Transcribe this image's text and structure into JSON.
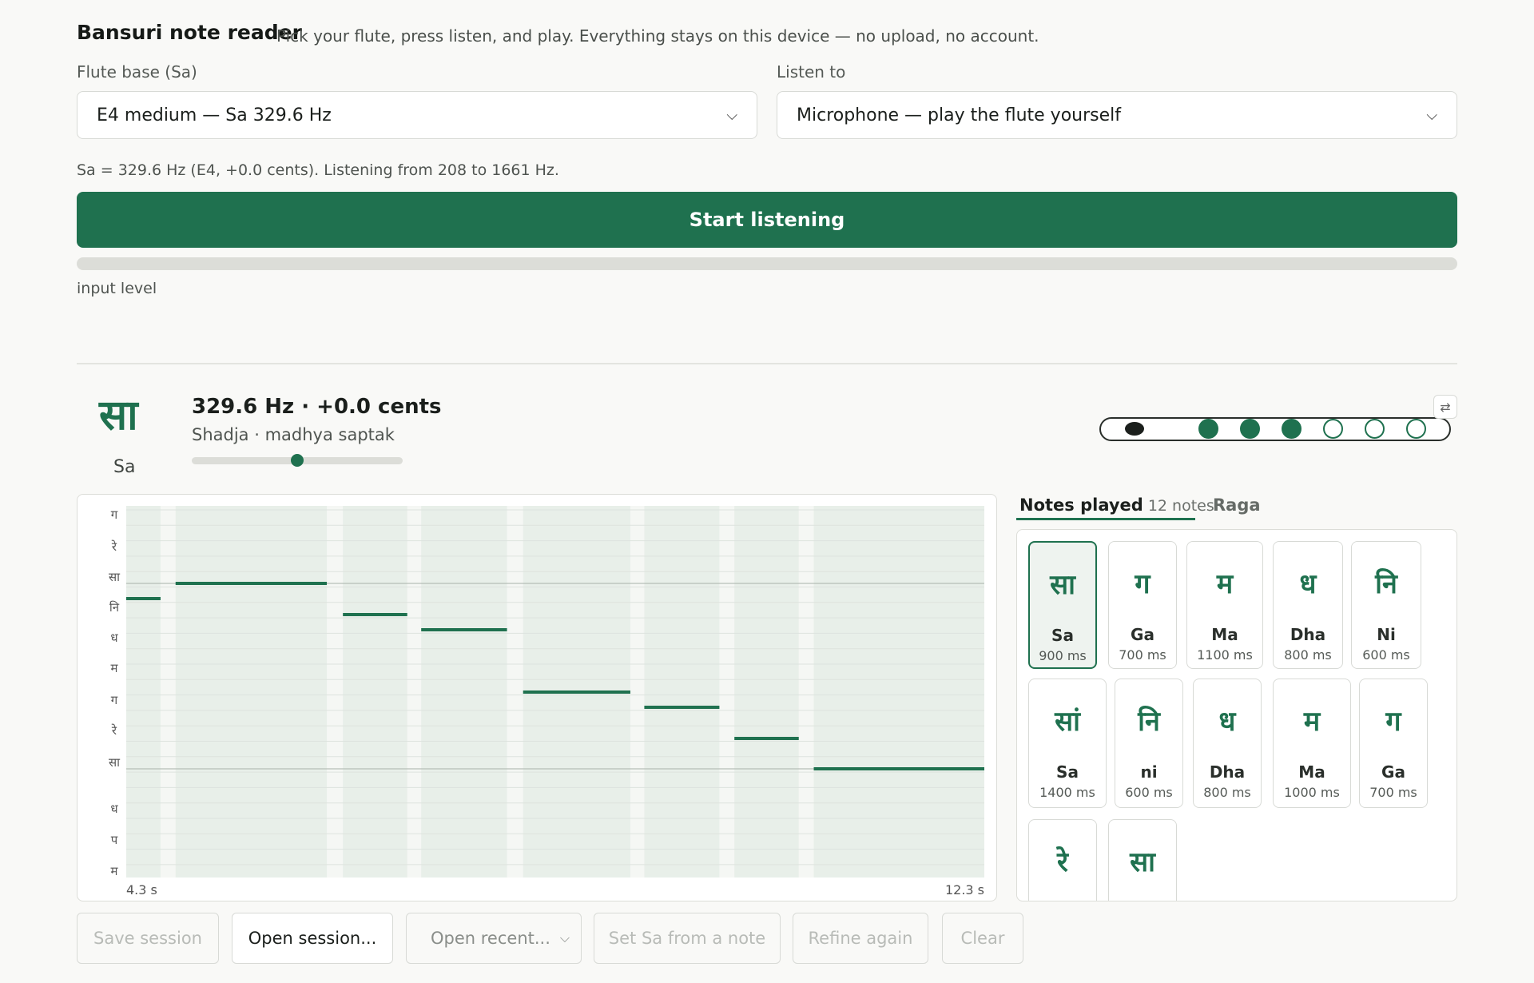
{
  "header": {
    "title": "Bansuri note reader",
    "subtitle": "Pick your flute, press listen, and play. Everything stays on this device — no upload, no account."
  },
  "flute_base": {
    "label": "Flute base (Sa)",
    "value": "E4 medium — Sa 329.6 Hz"
  },
  "listen_to": {
    "label": "Listen to",
    "value": "Microphone — play the flute yourself"
  },
  "status_line": "Sa = 329.6 Hz (E4, +0.0 cents). Listening from 208 to 1661 Hz.",
  "start_button": "Start listening",
  "input_level": {
    "label": "input level",
    "level": 0
  },
  "current_note": {
    "devanagari": "सा",
    "name": "Sa",
    "frequency_text": "329.6 Hz · +0.0 cents",
    "description": "Shadja · madhya saptak",
    "cents_offset": 0
  },
  "flute_diagram": {
    "holes": [
      "closed",
      "closed",
      "closed",
      "open",
      "open",
      "open"
    ],
    "swap_icon": "swap-icon"
  },
  "chart": {
    "y_labels": [
      "ग",
      "रे",
      "सा",
      "नि",
      "ध",
      "म",
      "ग",
      "रे",
      "सा",
      "ध",
      "प",
      "म"
    ],
    "t_start": "4.3 s",
    "t_end": "12.3 s"
  },
  "chart_data": {
    "type": "pitch-timeline",
    "x_range_s": [
      4.3,
      12.3
    ],
    "rows": [
      "म",
      "प",
      "ध",
      "सा",
      "रे",
      "ग",
      "म",
      "ध",
      "नि",
      "सा",
      "रे",
      "ग"
    ],
    "segments": [
      {
        "note": "Sa",
        "start": 4.3,
        "end": 4.62
      },
      {
        "note": "Sa (taar)",
        "start": 4.76,
        "end": 6.17
      },
      {
        "note": "ni",
        "start": 6.32,
        "end": 6.92
      },
      {
        "note": "Dha",
        "start": 7.05,
        "end": 7.85
      },
      {
        "note": "Ma",
        "start": 8.0,
        "end": 9.0
      },
      {
        "note": "Ga",
        "start": 9.13,
        "end": 9.83
      },
      {
        "note": "Re",
        "start": 9.97,
        "end": 10.57
      },
      {
        "note": "Sa",
        "start": 10.71,
        "end": 12.3
      }
    ]
  },
  "tabs": {
    "notes_label": "Notes played",
    "notes_count": "12 notes",
    "raga_label": "Raga"
  },
  "notes": [
    {
      "dev": "सा",
      "name": "Sa",
      "ms": "900 ms"
    },
    {
      "dev": "ग",
      "name": "Ga",
      "ms": "700 ms"
    },
    {
      "dev": "म",
      "name": "Ma",
      "ms": "1100 ms"
    },
    {
      "dev": "ध",
      "name": "Dha",
      "ms": "800 ms"
    },
    {
      "dev": "नि",
      "name": "Ni",
      "ms": "600 ms"
    },
    {
      "dev": "सां",
      "name": "Sa",
      "ms": "1400 ms"
    },
    {
      "dev": "नि",
      "name": "ni",
      "ms": "600 ms"
    },
    {
      "dev": "ध",
      "name": "Dha",
      "ms": "800 ms"
    },
    {
      "dev": "म",
      "name": "Ma",
      "ms": "1000 ms"
    },
    {
      "dev": "ग",
      "name": "Ga",
      "ms": "700 ms"
    },
    {
      "dev": "रे",
      "name": "",
      "ms": ""
    },
    {
      "dev": "सा",
      "name": "",
      "ms": ""
    }
  ],
  "actions": {
    "save": "Save session",
    "open": "Open session...",
    "open_recent": "Open recent...",
    "set_sa": "Set Sa from a note",
    "refine": "Refine again",
    "clear": "Clear"
  },
  "colors": {
    "accent": "#1f714f",
    "panel_bg": "#edf2ee"
  }
}
